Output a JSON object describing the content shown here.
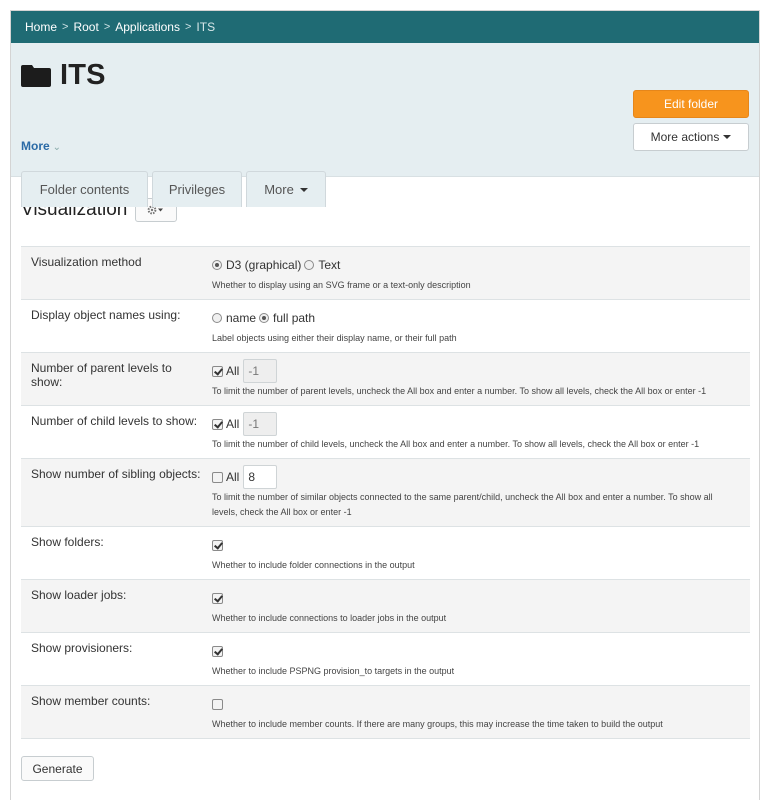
{
  "breadcrumb": {
    "items": [
      "Home",
      "Root",
      "Applications"
    ],
    "current": "ITS"
  },
  "header": {
    "title": "ITS",
    "more_label": "More",
    "edit_button": "Edit folder",
    "more_actions_button": "More actions"
  },
  "tabs": [
    "Folder contents",
    "Privileges",
    "More"
  ],
  "visualization": {
    "heading": "Visualization",
    "rows": [
      {
        "label": "Visualization method",
        "hint": "Whether to display using an SVG frame or a text-only description",
        "option1": "D3 (graphical)",
        "option2": "Text"
      },
      {
        "label": "Display object names using:",
        "hint": "Label objects using either their display name, or their full path",
        "option1": "name",
        "option2": "full path"
      },
      {
        "label": "Number of parent levels to show:",
        "hint": "To limit the number of parent levels, uncheck the All box and enter a number. To show all levels, check the All box or enter -1",
        "check_label": "All",
        "value": "-1"
      },
      {
        "label": "Number of child levels to show:",
        "hint": "To limit the number of child levels, uncheck the All box and enter a number. To show all levels, check the All box or enter -1",
        "check_label": "All",
        "value": "-1"
      },
      {
        "label": "Show number of sibling objects:",
        "hint": "To limit the number of similar objects connected to the same parent/child, uncheck the All box and enter a number. To show all levels, check the All box or enter -1",
        "check_label": "All",
        "value": "8"
      },
      {
        "label": "Show folders:",
        "hint": "Whether to include folder connections in the output"
      },
      {
        "label": "Show loader jobs:",
        "hint": "Whether to include connections to loader jobs in the output"
      },
      {
        "label": "Show provisioners:",
        "hint": "Whether to include PSPNG provision_to targets in the output"
      },
      {
        "label": "Show member counts:",
        "hint": "Whether to include member counts. If there are many groups, this may increase the time taken to build the output"
      }
    ],
    "generate_button": "Generate"
  },
  "colors": {
    "breadcrumb_bar": "#1f6b74",
    "header_bg": "#e5eef1",
    "accent_button": "#f7941d",
    "link": "#2a6aa6"
  }
}
